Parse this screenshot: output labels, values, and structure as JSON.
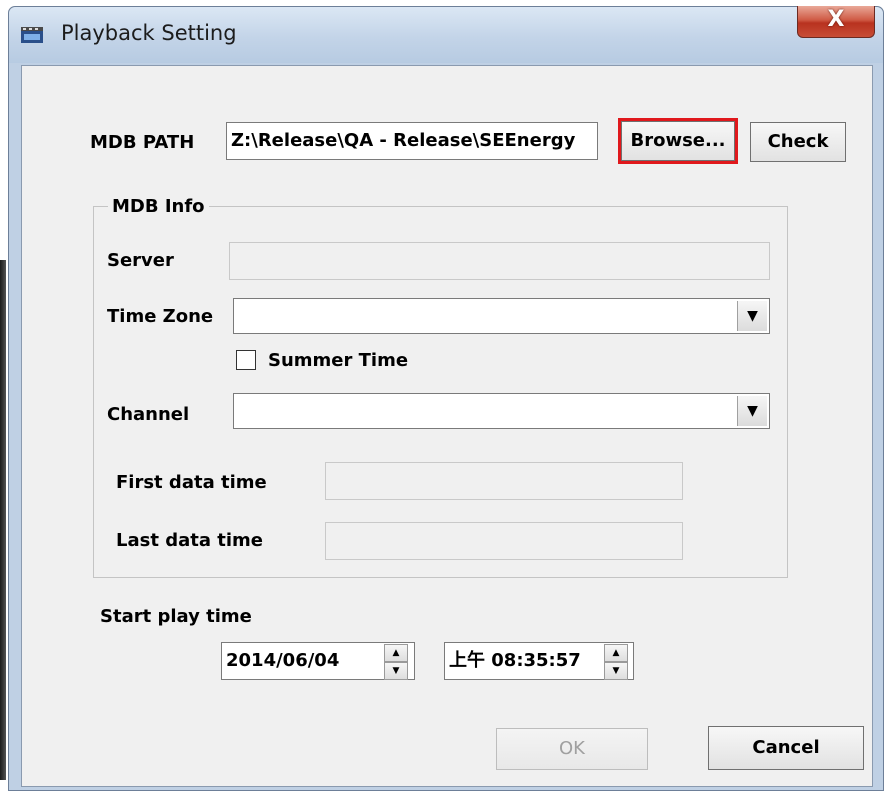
{
  "window": {
    "title": "Playback Setting",
    "close_label": "X"
  },
  "path": {
    "label": "MDB PATH",
    "value": "Z:\\Release\\QA - Release\\SEEnergy",
    "browse_label": "Browse...",
    "check_label": "Check"
  },
  "info": {
    "group_title": "MDB Info",
    "server_label": "Server",
    "server_value": "",
    "timezone_label": "Time Zone",
    "timezone_value": "",
    "summer_label": "Summer Time",
    "summer_checked": false,
    "channel_label": "Channel",
    "channel_value": "",
    "first_label": "First data time",
    "first_value": "",
    "last_label": "Last data time",
    "last_value": ""
  },
  "start": {
    "label": "Start play time",
    "date": "2014/06/04",
    "time": "上午 08:35:57"
  },
  "footer": {
    "ok_label": "OK",
    "cancel_label": "Cancel"
  },
  "colors": {
    "highlight": "#e0181c",
    "titlebar": "#c3d4e8",
    "close": "#c84d36"
  }
}
